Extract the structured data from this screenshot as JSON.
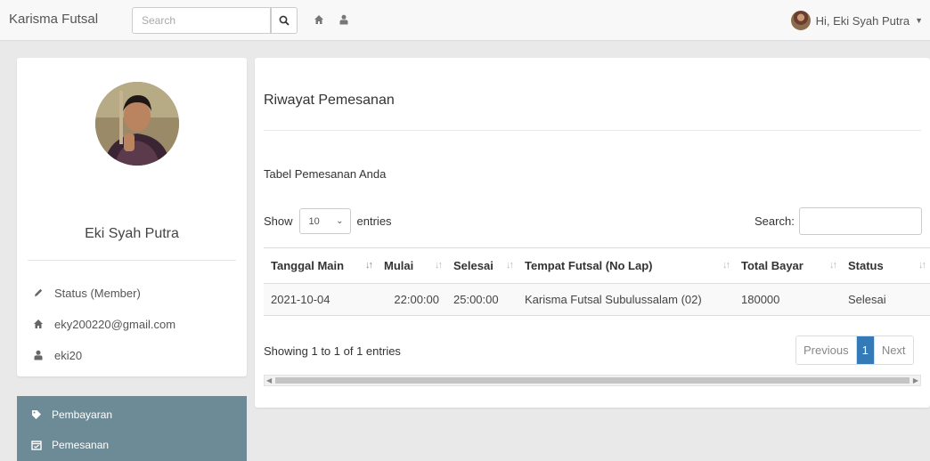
{
  "navbar": {
    "brand": "Karisma Futsal",
    "search_placeholder": "Search",
    "user_greeting": "Hi, Eki Syah Putra"
  },
  "profile": {
    "name": "Eki Syah Putra",
    "status": "Status (Member)",
    "email": "eky200220@gmail.com",
    "username": "eki20"
  },
  "menu": {
    "items": [
      {
        "label": "Pembayaran",
        "icon": "tag-icon"
      },
      {
        "label": "Pemesanan",
        "icon": "calendar-check-icon"
      }
    ]
  },
  "main": {
    "title": "Riwayat Pemesanan",
    "subtitle": "Tabel Pemesanan Anda",
    "show_label": "Show",
    "entries_value": "10",
    "entries_label": "entries",
    "search_label": "Search:",
    "columns": [
      "Tanggal Main",
      "Mulai",
      "Selesai",
      "Tempat Futsal (No Lap)",
      "Total Bayar",
      "Status"
    ],
    "rows": [
      [
        "2021-10-04",
        "22:00:00",
        "25:00:00",
        "Karisma Futsal Subulussalam (02)",
        "180000",
        "Selesai"
      ]
    ],
    "info": "Showing 1 to 1 of 1 entries",
    "pagination": {
      "previous": "Previous",
      "current": "1",
      "next": "Next"
    }
  },
  "colors": {
    "menu_bg": "#6d8a97",
    "accent": "#337ab7"
  }
}
